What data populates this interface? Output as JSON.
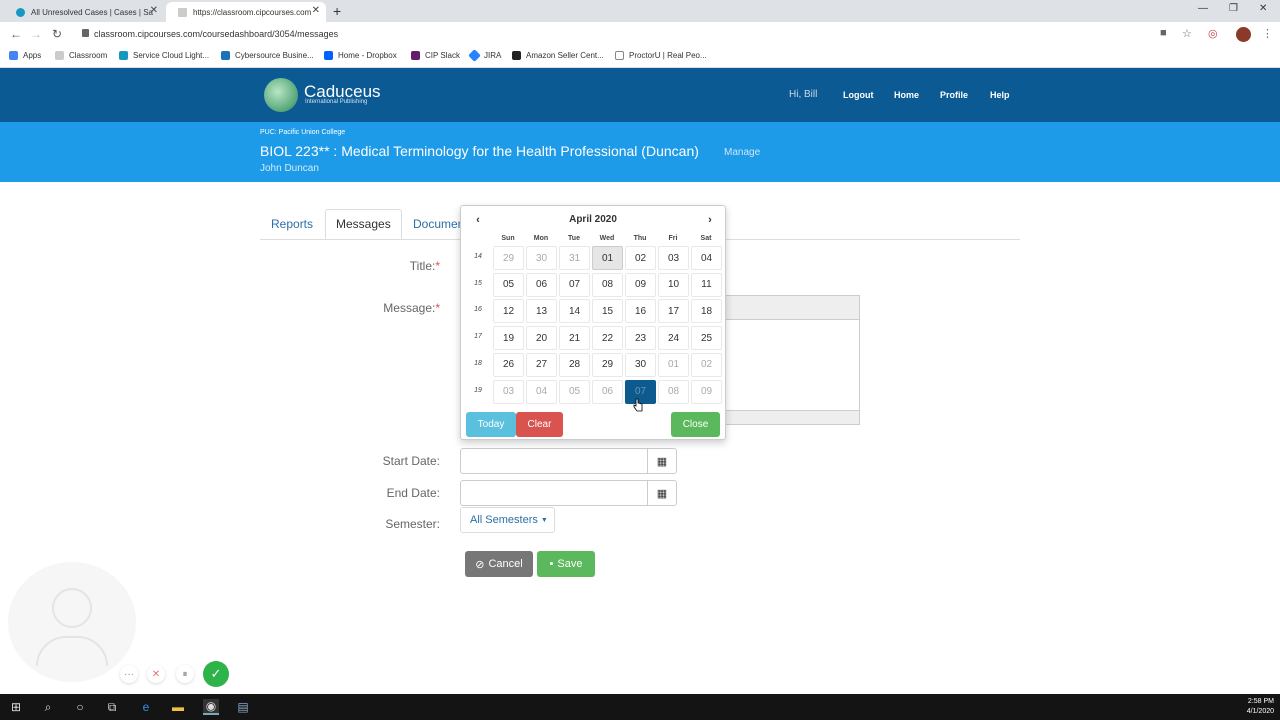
{
  "browser": {
    "tabs": [
      {
        "label": "All Unresolved Cases | Cases | Sa",
        "active": false
      },
      {
        "label": "https://classroom.cipcourses.com",
        "active": true
      }
    ],
    "url": "classroom.cipcourses.com/coursedashboard/3054/messages",
    "bookmarks": [
      "Apps",
      "Classroom",
      "Service Cloud Light...",
      "Cybersource Busine...",
      "Home - Dropbox",
      "CIP Slack",
      "JIRA",
      "Amazon Seller Cent...",
      "ProctorU | Real Peo..."
    ]
  },
  "site": {
    "brand": "Caduceus",
    "brand_sub": "International Publishing",
    "greeting": "Hi, Bill",
    "nav": [
      "Logout",
      "Home",
      "Profile",
      "Help"
    ]
  },
  "course": {
    "college": "PUC: Pacific Union College",
    "title": "BIOL 223** : Medical Terminology for the Health Professional (Duncan)",
    "manage": "Manage",
    "instructor": "John Duncan"
  },
  "page_tabs": [
    "Reports",
    "Messages",
    "Documen"
  ],
  "form": {
    "title_label": "Title:",
    "message_label": "Message:",
    "required_mark": "*",
    "start_label": "Start Date:",
    "end_label": "End Date:",
    "semester_label": "Semester:",
    "semester_value": "All Semesters",
    "cancel": "Cancel",
    "save": "Save"
  },
  "datepicker": {
    "month": "April 2020",
    "prev": "‹",
    "next": "›",
    "dow": [
      "Sun",
      "Mon",
      "Tue",
      "Wed",
      "Thu",
      "Fri",
      "Sat"
    ],
    "weeks": [
      {
        "num": "14",
        "days": [
          "29",
          "30",
          "31",
          "01",
          "02",
          "03",
          "04"
        ]
      },
      {
        "num": "15",
        "days": [
          "05",
          "06",
          "07",
          "08",
          "09",
          "10",
          "11"
        ]
      },
      {
        "num": "16",
        "days": [
          "12",
          "13",
          "14",
          "15",
          "16",
          "17",
          "18"
        ]
      },
      {
        "num": "17",
        "days": [
          "19",
          "20",
          "21",
          "22",
          "23",
          "24",
          "25"
        ]
      },
      {
        "num": "18",
        "days": [
          "26",
          "27",
          "28",
          "29",
          "30",
          "01",
          "02"
        ]
      },
      {
        "num": "19",
        "days": [
          "03",
          "04",
          "05",
          "06",
          "07",
          "08",
          "09"
        ]
      }
    ],
    "today_btn": "Today",
    "clear_btn": "Clear",
    "close_btn": "Close"
  },
  "taskbar": {
    "time": "2:58 PM",
    "date": "4/1/2020"
  },
  "colors": {
    "header": "#0c5a94",
    "banner": "#1e9be8",
    "today_btn": "#5bc0de",
    "clear_btn": "#d9534f",
    "close_btn": "#5cb85c",
    "selected_day": "#0d5a8f"
  }
}
